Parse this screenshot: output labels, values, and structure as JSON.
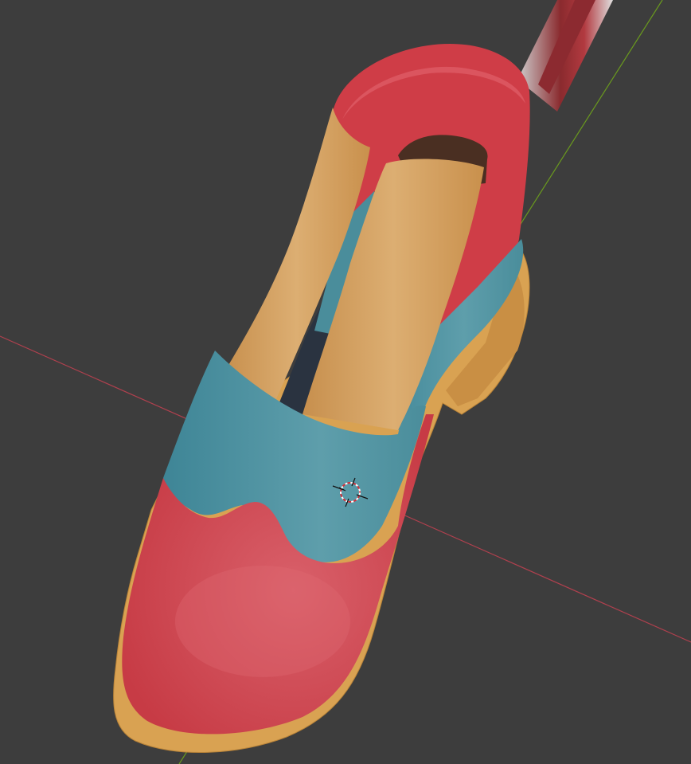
{
  "viewport": {
    "background": "#3d3d3d",
    "x_axis_color": "#b0404e",
    "y_axis_color": "#6a9a1e"
  },
  "object": {
    "name": "shoe",
    "materials": {
      "sole": "#d9a252",
      "vamp_red": "#d1434d",
      "quarter_teal": "#4e93a0",
      "strap_tan": "#d7a566",
      "lining": "#4a2f22",
      "inner_dark": "#2a3340"
    }
  },
  "cursor": {
    "icon": "3d-cursor-icon"
  }
}
